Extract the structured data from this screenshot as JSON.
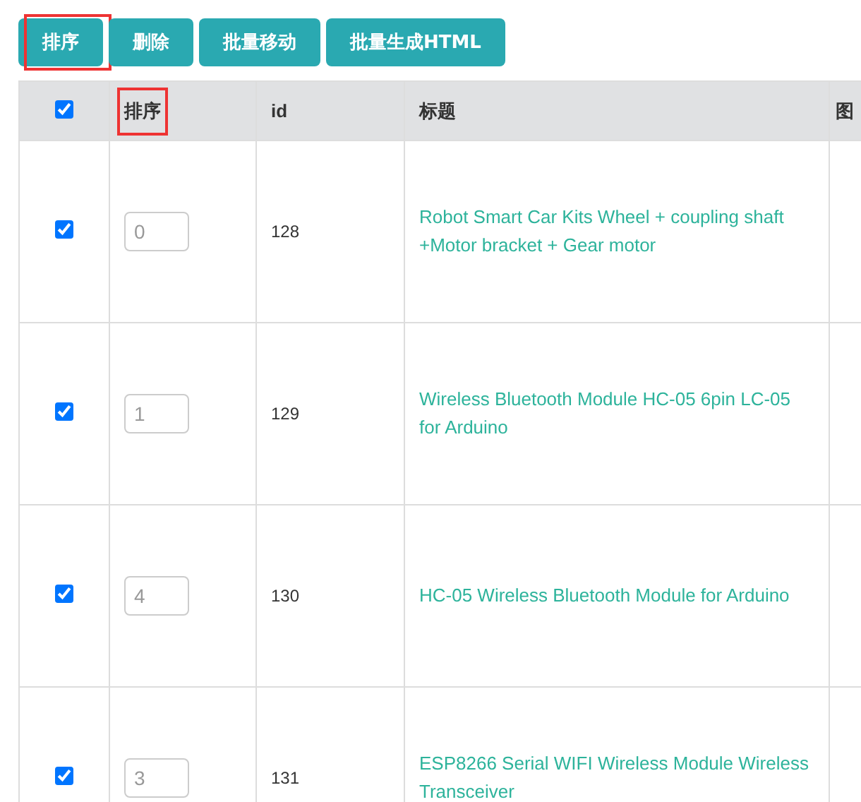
{
  "toolbar": {
    "buttons": [
      {
        "label": "排序",
        "highlighted": true
      },
      {
        "label": "删除",
        "highlighted": false
      },
      {
        "label": "批量移动",
        "highlighted": false
      },
      {
        "label": "批量生成HTML",
        "highlighted": false
      }
    ]
  },
  "table": {
    "select_all": {
      "checked": true
    },
    "columns": [
      {
        "label": "排序",
        "highlighted": true
      },
      {
        "label": "id",
        "highlighted": false
      },
      {
        "label": "标题",
        "highlighted": false
      },
      {
        "label": "图",
        "highlighted": false
      }
    ],
    "rows": [
      {
        "checked": true,
        "order": "0",
        "id": "128",
        "title": "Robot Smart Car Kits Wheel + coupling shaft +Motor bracket + Gear motor"
      },
      {
        "checked": true,
        "order": "1",
        "id": "129",
        "title": "Wireless Bluetooth Module HC-05 6pin LC-05 for Arduino"
      },
      {
        "checked": true,
        "order": "4",
        "id": "130",
        "title": "HC-05 Wireless Bluetooth Module for Arduino"
      },
      {
        "checked": true,
        "order": "3",
        "id": "131",
        "title": "ESP8266 Serial WIFI Wireless Module Wireless Transceiver"
      }
    ]
  }
}
